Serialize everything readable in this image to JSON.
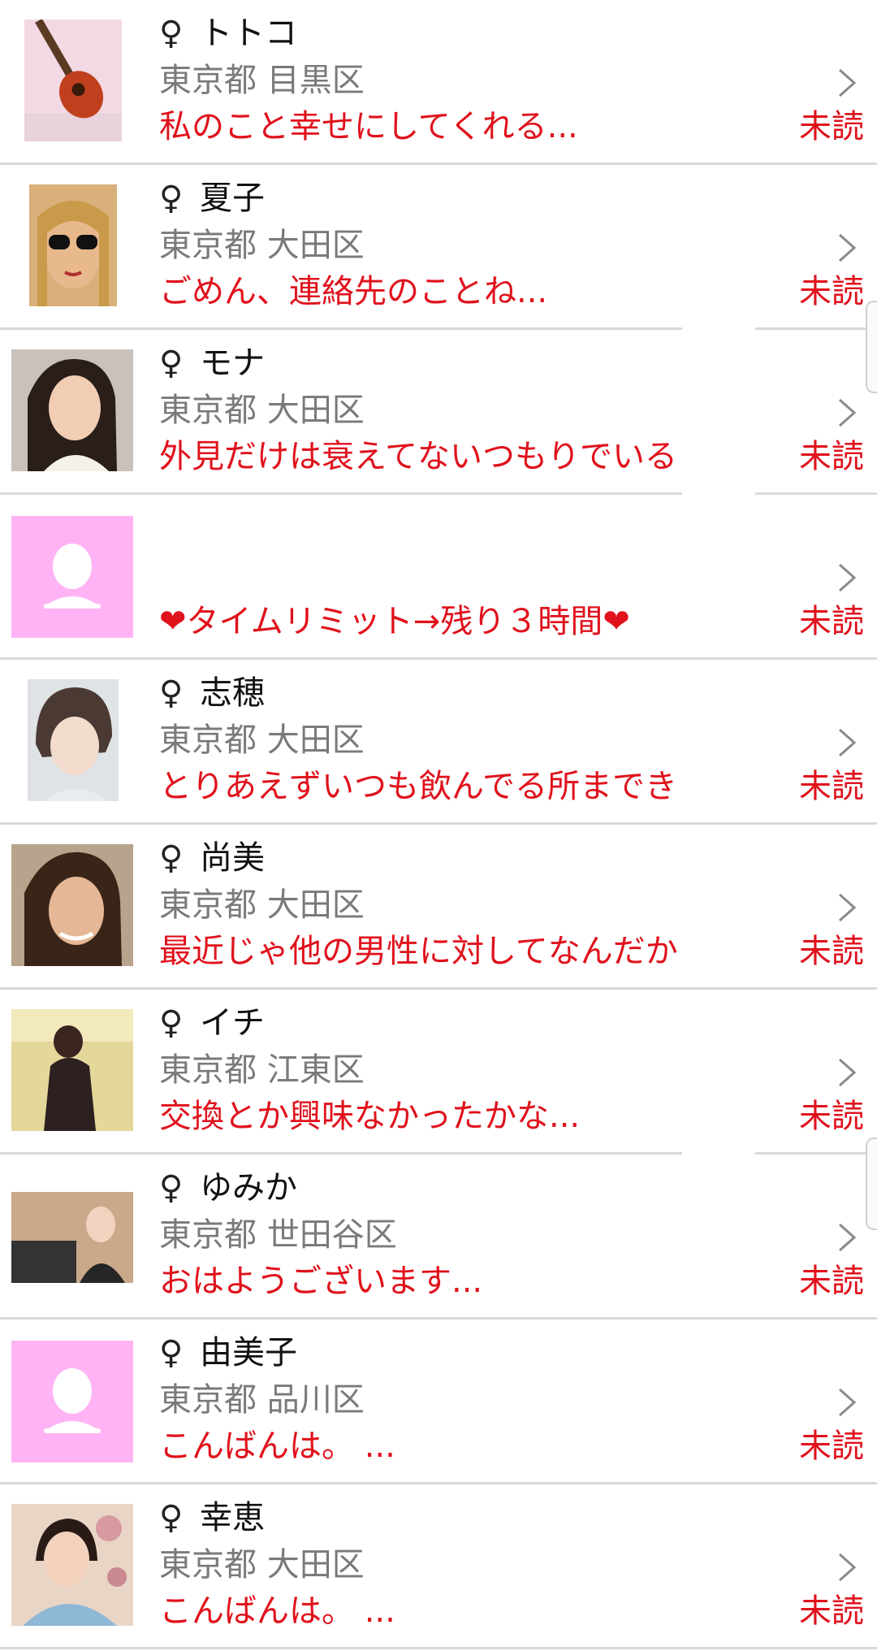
{
  "colors": {
    "accent": "#e0121c",
    "placeholder_avatar": "#ffb3f5"
  },
  "gender_symbol": "♀",
  "unread_label": "未読",
  "chevron_icon": "chevron-right-icon",
  "rows": [
    {
      "name": "トトコ",
      "location": "東京都 目黒区",
      "message": "私のこと幸せにしてくれる...",
      "avatar": "guitar-photo"
    },
    {
      "name": "夏子",
      "location": "東京都 大田区",
      "message": "ごめん、連絡先のことね...",
      "avatar": "sunglasses-woman-photo"
    },
    {
      "name": "モナ",
      "location": "東京都 大田区",
      "message": "外見だけは衰えてないつもりでいる",
      "avatar": "woman-photo"
    },
    {
      "name": "",
      "location": "",
      "message": "❤タイムリミット→残り３時間❤",
      "avatar": "default-user-icon"
    },
    {
      "name": "志穂",
      "location": "東京都 大田区",
      "message": "とりあえずいつも飲んでる所までき",
      "avatar": "woman-photo"
    },
    {
      "name": "尚美",
      "location": "東京都 大田区",
      "message": "最近じゃ他の男性に対してなんだか",
      "avatar": "woman-photo"
    },
    {
      "name": "イチ",
      "location": "東京都 江東区",
      "message": "交換とか興味なかったかな...",
      "avatar": "woman-photo"
    },
    {
      "name": "ゆみか",
      "location": "東京都 世田谷区",
      "message": "おはようございます...",
      "avatar": "woman-photo"
    },
    {
      "name": "由美子",
      "location": "東京都 品川区",
      "message": "こんばんは。 ...",
      "avatar": "default-user-icon"
    },
    {
      "name": "幸恵",
      "location": "東京都 大田区",
      "message": "こんばんは。 ...",
      "avatar": "kimono-woman-photo"
    }
  ]
}
